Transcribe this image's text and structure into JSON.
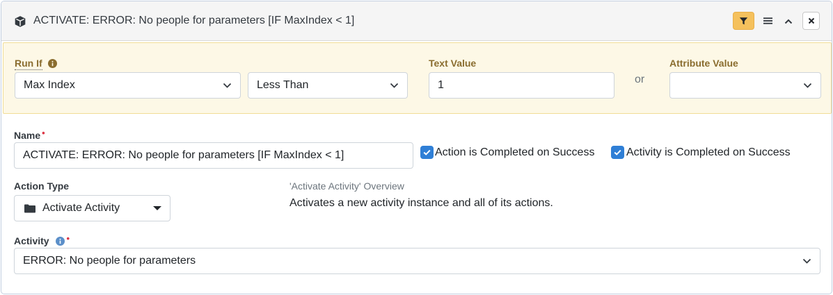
{
  "header": {
    "title": "ACTIVATE: ERROR: No people for parameters [IF MaxIndex < 1]",
    "icons": [
      "cube-icon",
      "filter-icon",
      "menu-icon",
      "chevron-up-icon",
      "close-icon"
    ],
    "filter_color": "#f5c15d"
  },
  "run_if": {
    "label": "Run If",
    "field": "Max Index",
    "operator": "Less Than",
    "text_value_label": "Text Value",
    "text_value": "1",
    "or_label": "or",
    "attribute_value_label": "Attribute Value",
    "attribute_value": "",
    "background": "#fdf8e6"
  },
  "name": {
    "label": "Name",
    "value": "ACTIVATE: ERROR: No people for parameters [IF MaxIndex < 1]",
    "required_mark": "•"
  },
  "checkboxes": {
    "action_completed": {
      "label": "Action is Completed on Success",
      "checked": true
    },
    "activity_completed": {
      "label": "Activity is Completed on Success",
      "checked": true
    }
  },
  "action_type": {
    "label": "Action Type",
    "value": "Activate Activity",
    "icon": "folder-icon"
  },
  "overview": {
    "title": "'Activate Activity' Overview",
    "description": "Activates a new activity instance and all of its actions."
  },
  "activity": {
    "label": "Activity",
    "value": "ERROR: No people for parameters",
    "required_mark": "•"
  }
}
